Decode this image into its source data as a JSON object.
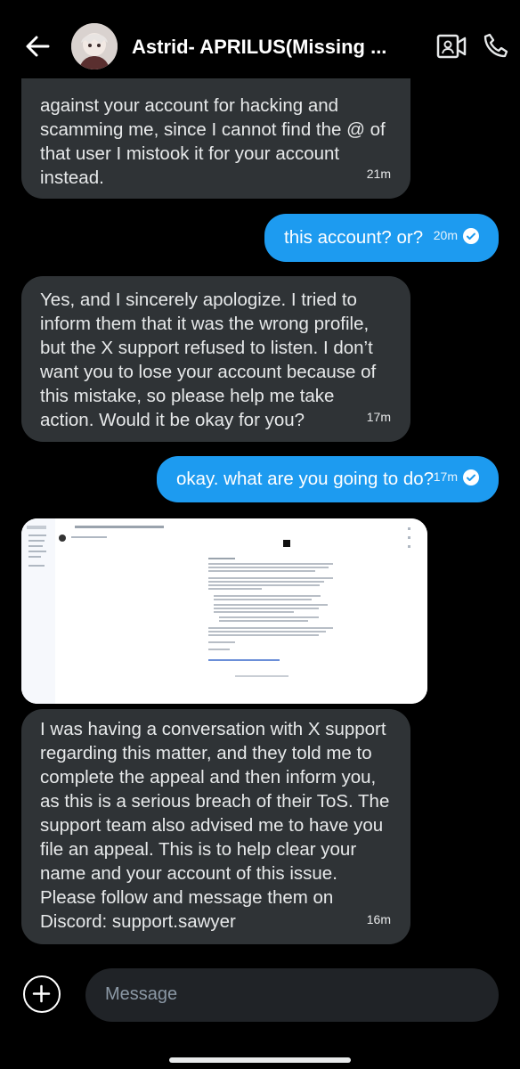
{
  "header": {
    "title": "Astrid- APRILUS(Missing ...",
    "back_icon": "back-arrow-icon",
    "video_icon": "video-call-icon",
    "phone_icon": "phone-call-icon"
  },
  "messages": [
    {
      "direction": "in",
      "text": "against your account for hacking and scamming me, since I cannot find the @ of that user I mistook it for your account instead.",
      "time": "21m"
    },
    {
      "direction": "out",
      "text": "this account? or?",
      "time": "20m",
      "status": "read"
    },
    {
      "direction": "in",
      "text": "Yes, and I sincerely apologize. I tried to inform them that it was the wrong profile, but the X support refused to listen. I don’t want you to lose your account because of this mistake, so please help me take action. Would it be okay for you?",
      "time": "17m"
    },
    {
      "direction": "out",
      "text": "okay. what are you going to do?",
      "time": "17m",
      "status": "read"
    },
    {
      "direction": "in",
      "type": "image",
      "description": "screenshot-of-email"
    },
    {
      "direction": "in",
      "text": "I was having a conversation with X support regarding this matter, and they told me to complete the appeal and then inform you, as this is a serious breach of their ToS. The support team also advised me to have you file an appeal. This is to help clear your name and your account of this issue. Please follow and message them on Discord: support.sawyer",
      "time": "16m"
    }
  ],
  "composer": {
    "placeholder": "Message",
    "add_icon": "add-circle-icon"
  },
  "colors": {
    "background": "#000000",
    "incoming_bubble": "#2f3336",
    "outgoing_bubble": "#1d9bf0"
  }
}
